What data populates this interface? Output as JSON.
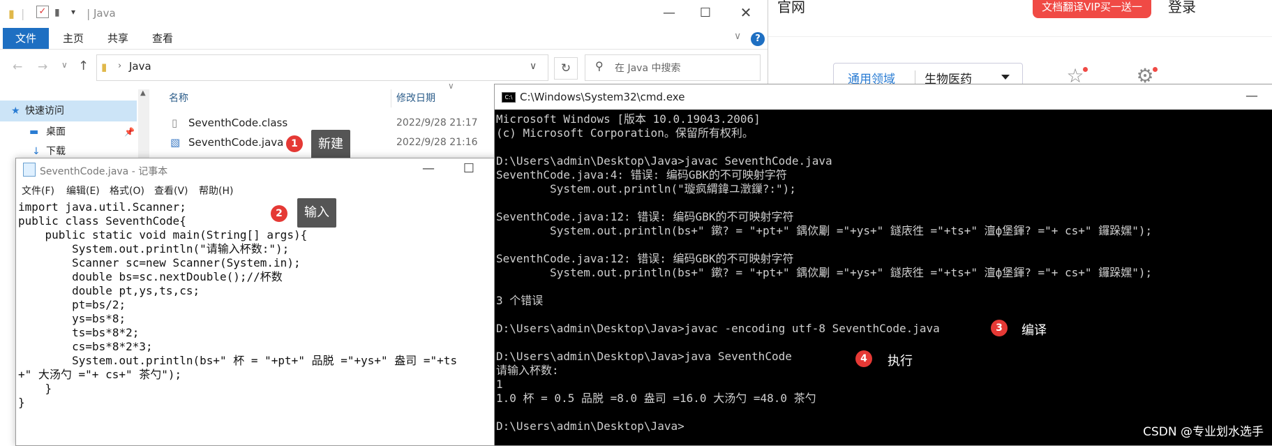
{
  "browser": {
    "official_text": "官网",
    "vip_button": "文档翻译VIP买一送一",
    "login": "登录",
    "filter_primary": "通用领域",
    "filter_secondary": "生物医药"
  },
  "explorer": {
    "title": "Java",
    "tabs": [
      "文件",
      "主页",
      "共享",
      "查看"
    ],
    "address": "Java",
    "search_placeholder": "在 Java 中搜索",
    "nav": [
      "快速访问",
      "桌面",
      "下载"
    ],
    "columns": {
      "name": "名称",
      "date": "修改日期"
    },
    "files": [
      {
        "name": "SeventhCode.class",
        "date": "2022/9/28 21:17"
      },
      {
        "name": "SeventhCode.java",
        "date": "2022/9/28 21:16"
      }
    ]
  },
  "notepad": {
    "title": "SeventhCode.java - 记事本",
    "menu": [
      "文件(F)",
      "编辑(E)",
      "格式(O)",
      "查看(V)",
      "帮助(H)"
    ],
    "content": "import java.util.Scanner;\npublic class SeventhCode{\n    public static void main(String[] args){\n        System.out.println(\"请输入杯数:\");\n        Scanner sc=new Scanner(System.in);\n        double bs=sc.nextDouble();//杯数\n        double pt,ys,ts,cs;\n        pt=bs/2;\n        ys=bs*8;\n        ts=bs*8*2;\n        cs=bs*8*2*3;\n        System.out.println(bs+\" 杯 = \"+pt+\" 品脱 =\"+ys+\" 盎司 =\"+ts\n+\" 大汤勺 =\"+ cs+\" 茶勺\");\n    }\n}"
  },
  "cmd": {
    "title": "C:\\Windows\\System32\\cmd.exe",
    "content": "Microsoft Windows [版本 10.0.19043.2006]\n(c) Microsoft Corporation。保留所有权利。\n\nD:\\Users\\admin\\Desktop\\Java>javac SeventhCode.java\nSeventhCode.java:4: 错误: 编码GBK的不可映射字符\n        System.out.println(\"璇疯緭鍏ユ澂鏁?:\");\n\nSeventhCode.java:12: 错误: 编码GBK的不可映射字符\n        System.out.println(bs+\" 鏉? = \"+pt+\" 鍝佽劚 =\"+ys+\" 鐩庡徃 =\"+ts+\" 澶ф堡鍕? =\"+ cs+\" 鑼跺嫼\");\n\nSeventhCode.java:12: 错误: 编码GBK的不可映射字符\n        System.out.println(bs+\" 鏉? = \"+pt+\" 鍝佽劚 =\"+ys+\" 鐩庡徃 =\"+ts+\" 澶ф堡鍕? =\"+ cs+\" 鑼跺嫼\");\n\n3 个错误\n\nD:\\Users\\admin\\Desktop\\Java>javac -encoding utf-8 SeventhCode.java\n\nD:\\Users\\admin\\Desktop\\Java>java SeventhCode\n请输入杯数:\n1\n1.0 杯 = 0.5 品脱 =8.0 盎司 =16.0 大汤勺 =48.0 茶勺\n\nD:\\Users\\admin\\Desktop\\Java>"
  },
  "annotations": {
    "a1": {
      "num": "1",
      "label": "新建"
    },
    "a2": {
      "num": "2",
      "label": "输入"
    },
    "a3": {
      "num": "3",
      "label": "编译"
    },
    "a4": {
      "num": "4",
      "label": "执行"
    }
  },
  "watermark": "CSDN @专业划水选手",
  "icons": [
    "folder-icon",
    "checkbox-icon",
    "help-icon",
    "search-icon",
    "star-icon",
    "desktop-icon",
    "download-icon",
    "pin-icon",
    "file-icon",
    "java-file-icon",
    "notepad-icon",
    "cmd-icon",
    "minimize-icon",
    "maximize-icon",
    "close-icon",
    "refresh-icon",
    "gear-icon",
    "bookmark-icon"
  ],
  "colors": {
    "ribbon_active": "#1e6fc2",
    "badge": "#e53935",
    "cmd_bg": "#000000",
    "vip": "#f04a45",
    "link": "#2a7cd3"
  }
}
